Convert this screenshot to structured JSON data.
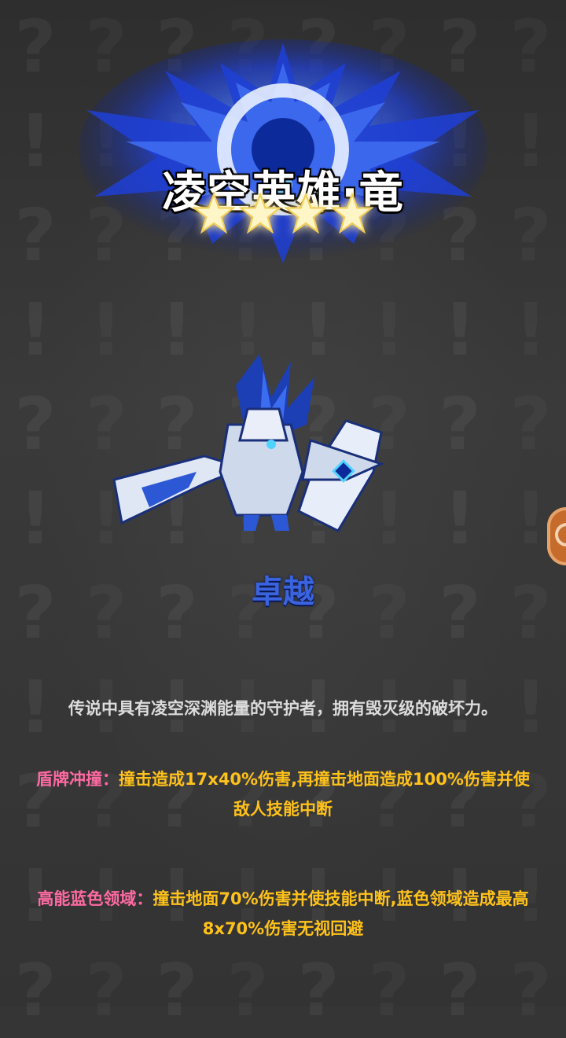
{
  "hero": {
    "title": "凌空英雄·竜",
    "stars": 4,
    "rank": "卓越"
  },
  "description": "传说中具有凌空深渊能量的守护者，拥有毁灭级的破坏力。",
  "skills": [
    {
      "name": "盾牌冲撞：",
      "text": "撞击造成17x40%伤害,再撞击地面造成100%伤害并使敌人技能中断"
    },
    {
      "name": "高能蓝色领域：",
      "text": "撞击地面70%伤害并使技能中断,蓝色领域造成最高8x70%伤害无视回避"
    }
  ],
  "colors": {
    "background": "#353535",
    "badge_blue": "#1f3fd6",
    "rank": "#3a63e0",
    "skill_name": "#ff6aa2",
    "skill_text": "#ffc21a",
    "star": "#fff6c8"
  },
  "icons": {
    "side_button": "heart-icon",
    "star": "star-icon"
  }
}
